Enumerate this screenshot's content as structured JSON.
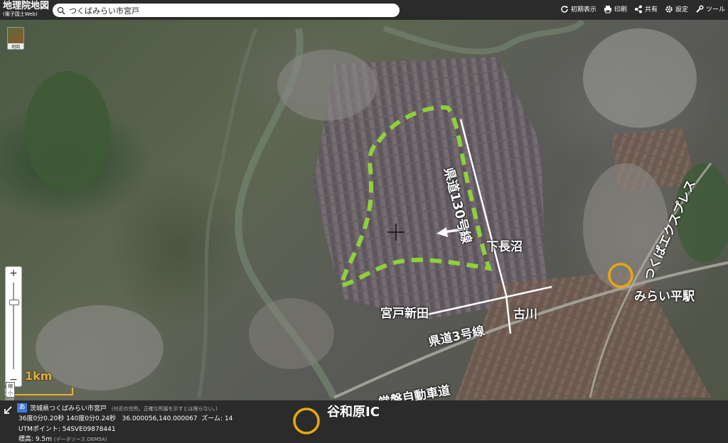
{
  "app": {
    "title_line1": "地理院地図",
    "title_line2": "(電子国土Web)"
  },
  "search": {
    "value": "つくばみらい市宮戸",
    "placeholder": ""
  },
  "toolbar": {
    "reset": "初期表示",
    "print": "印刷",
    "share": "共有",
    "settings": "設定",
    "tools": "ツール"
  },
  "layer_button": {
    "label": "地図"
  },
  "zoom": {
    "plus": "+",
    "minus": "−"
  },
  "scale": {
    "label": "1km",
    "shrink": "縮小",
    "ticks": "0              500             1000"
  },
  "map_labels": {
    "route130": "県道130号線",
    "shimonaganuma": "下長沼",
    "miyado_shinden": "宮戸新田",
    "furukawa": "古川",
    "route3": "県道3号線",
    "tx": "つくばエクスプレス",
    "miraidaira": "みらい平駅",
    "joban": "常磐自動車道",
    "yawara_ic": "谷和原IC"
  },
  "info": {
    "addr_icon": "あ",
    "address": "茨城県つくばみらい市宮戸",
    "address_note": "(付近の住所。正確な所属を示すとは限らない。)",
    "dms": "36度0分0.20秒 140度0分0.24秒",
    "decimal": "36.000056,140.000067",
    "zoom_label": "ズーム:",
    "zoom_value": "14",
    "utm_label": "UTMポイント:",
    "utm_value": "54SVE09878441",
    "elev_label": "標高:",
    "elev_value": "9.5m",
    "elev_source": "(データソース:DEM5A)"
  },
  "colors": {
    "highlight_dash": "#8fd13a",
    "marker_circle": "#e8a90e",
    "topbar": "#2b2b2b"
  }
}
